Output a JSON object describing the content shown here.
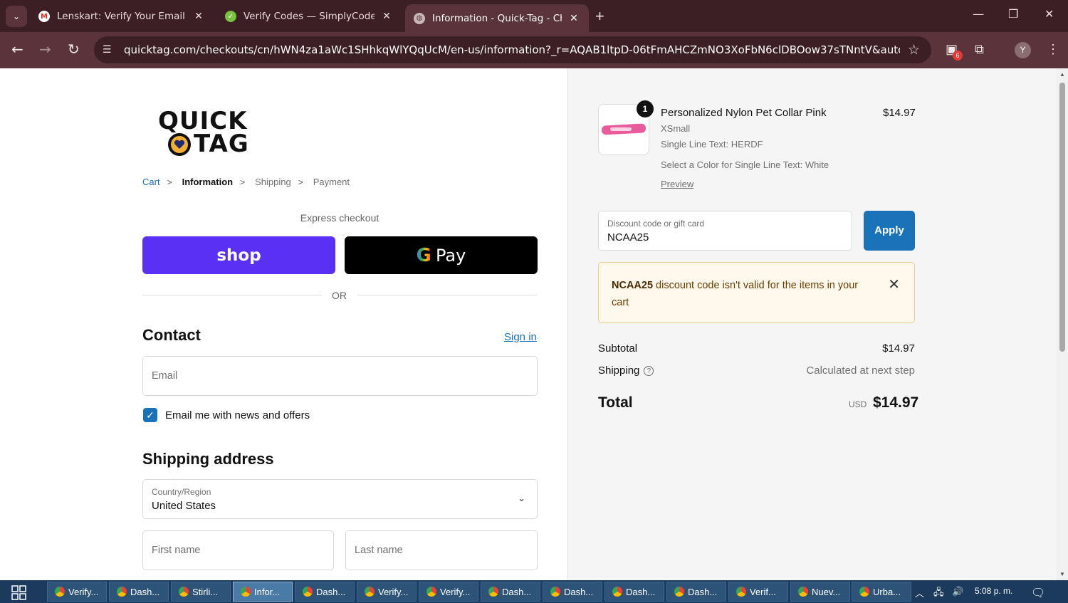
{
  "browser": {
    "tabs": [
      {
        "title": "Lenskart: Verify Your Email - yus",
        "favicon": "gmail-icon",
        "active": false
      },
      {
        "title": "Verify Codes — SimplyCodes",
        "favicon": "simplycodes-icon",
        "active": false
      },
      {
        "title": "Information - Quick-Tag - Checl",
        "favicon": "globe-icon",
        "active": true
      }
    ],
    "url": "quicktag.com/checkouts/cn/hWN4za1aWc1SHhkqWlYQqUcM/en-us/information?_r=AQAB1ltpD-06tFmAHCZmNO3XoFbN6clDBOow37sTNntV&auto_redirec...",
    "extension_badge": "6",
    "profile_initial": "Y"
  },
  "logo": {
    "line1": "QUICK",
    "line2": "TAG"
  },
  "breadcrumb": {
    "cart": "Cart",
    "information": "Information",
    "shipping": "Shipping",
    "payment": "Payment"
  },
  "express": {
    "label": "Express checkout",
    "shop": "shop",
    "gpay": "Pay",
    "or": "OR"
  },
  "contact": {
    "heading": "Contact",
    "signin": "Sign in",
    "email_placeholder": "Email",
    "news_label": "Email me with news and offers"
  },
  "shipping": {
    "heading": "Shipping address",
    "country_label": "Country/Region",
    "country_value": "United States",
    "first_name_placeholder": "First name",
    "last_name_placeholder": "Last name"
  },
  "order": {
    "quantity": "1",
    "product_name": "Personalized Nylon Pet Collar Pink",
    "price": "$14.97",
    "size": "XSmall",
    "line_text": "Single Line Text: HERDF",
    "color": "Select a Color for Single Line Text: White",
    "preview": "Preview"
  },
  "discount": {
    "label": "Discount code or gift card",
    "value": "NCAA25",
    "apply": "Apply",
    "error_code": "NCAA25",
    "error_message": " discount code isn't valid for the items in your cart"
  },
  "summary": {
    "subtotal_label": "Subtotal",
    "subtotal_value": "$14.97",
    "shipping_label": "Shipping",
    "shipping_value": "Calculated at next step",
    "total_label": "Total",
    "currency": "USD",
    "total_value": "$14.97"
  },
  "taskbar": {
    "items": [
      "Verify...",
      "Dash...",
      "Stirli...",
      "Infor...",
      "Dash...",
      "Verify...",
      "Verify...",
      "Dash...",
      "Dash...",
      "Dash...",
      "Dash...",
      "Verif...",
      "Nuev...",
      "Urba..."
    ],
    "active_index": 3,
    "clock": "5:08 p. m."
  },
  "colors": {
    "accent": "#1a73b8",
    "shop_purple": "#5a31f4",
    "chrome": "#3c1f24"
  }
}
